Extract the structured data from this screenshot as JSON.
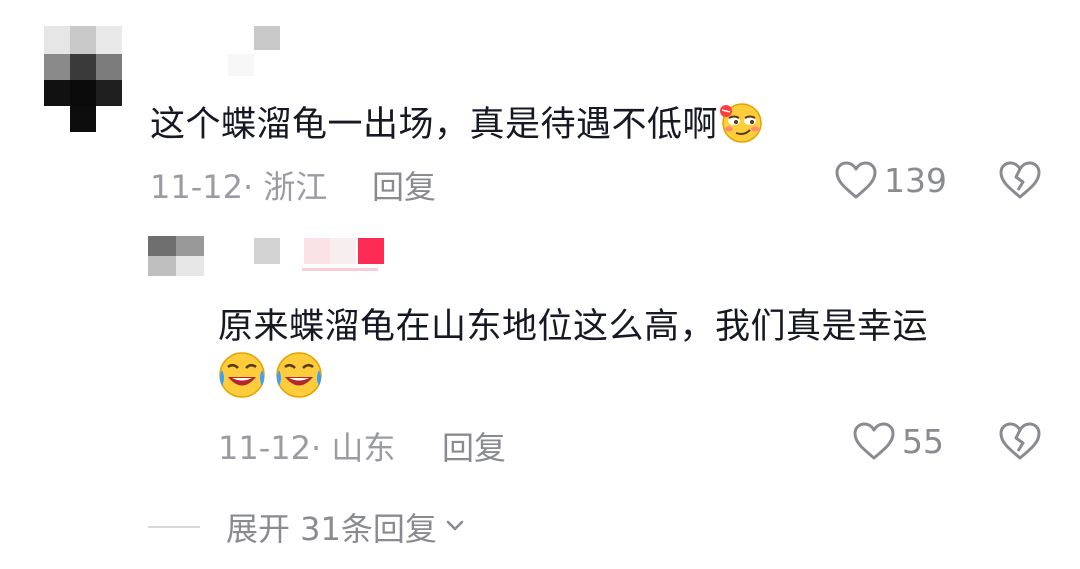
{
  "comment": {
    "text": "这个蝶溜龟一出场，真是待遇不低啊",
    "emoji": "smirk-face-emoji",
    "date": "11-12",
    "location": "浙江",
    "reply_label": "回复",
    "likes": "139"
  },
  "reply": {
    "text_line1": "原来蝶溜龟在山东地位这么高，我们真是幸运",
    "emoji": "crying-laughing-emoji",
    "date": "11-12",
    "location": "山东",
    "reply_label": "回复",
    "likes": "55"
  },
  "expand": {
    "label": "展开 31条回复"
  },
  "colors": {
    "text": "#161823",
    "secondary": "#8a8b90",
    "tag_pink": "#fe2c55"
  }
}
